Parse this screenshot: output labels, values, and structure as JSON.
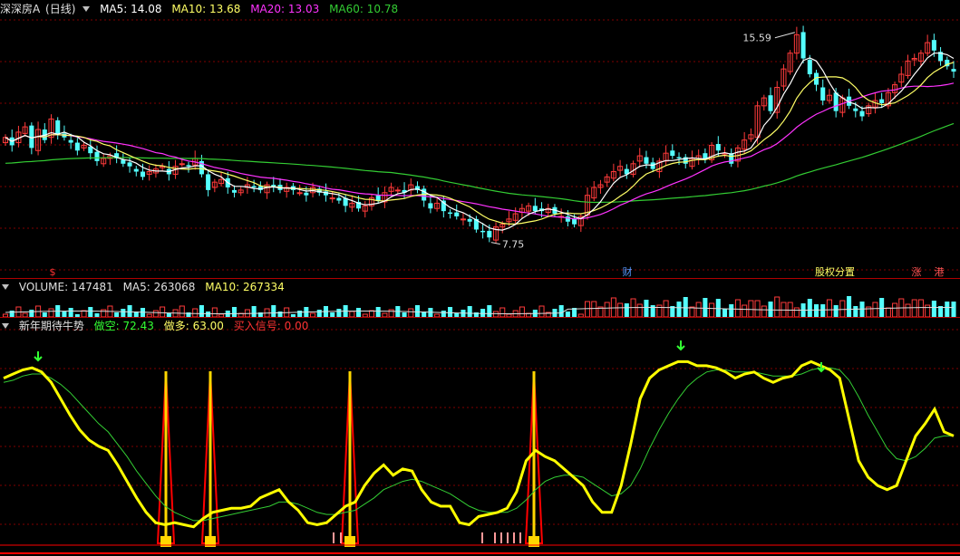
{
  "colors": {
    "bg": "#000000",
    "grid": "#800000",
    "up": "#ff3b3b",
    "down": "#54ffff",
    "ma5": "#ffffff",
    "ma10": "#ffff66",
    "ma20": "#ff33ff",
    "ma60": "#33cc33",
    "fast": "#ffff00",
    "slow": "#33cc33",
    "signal": "#ff0000",
    "signal_fill": "#ffd700"
  },
  "price_panel": {
    "title": "深深房A",
    "period": "(日线)",
    "ma5": "MA5: 14.08",
    "ma10": "MA10: 13.68",
    "ma20": "MA20: 13.03",
    "ma60": "MA60: 10.78",
    "high_label": "15.59",
    "low_label": "7.75",
    "markers": [
      "$",
      "财",
      "股权分置",
      "涨",
      "港"
    ]
  },
  "volume_panel": {
    "title": "VOLUME: 147481",
    "ma5": "MA5: 263068",
    "ma10": "MA10: 267334"
  },
  "indicator_panel": {
    "title": "新年期待牛势",
    "short": "做空: 72.43",
    "long": "做多: 63.00",
    "buy": "买入信号: 0.00"
  },
  "chart_data": [
    {
      "type": "candlestick",
      "name": "price",
      "ylim": [
        6.5,
        16.2
      ],
      "close": [
        11.6,
        11.3,
        11.8,
        12.0,
        11.2,
        11.9,
        11.5,
        12.3,
        11.7,
        11.6,
        11.4,
        11.1,
        11.3,
        11.0,
        10.7,
        10.8,
        10.9,
        10.8,
        10.6,
        10.5,
        10.3,
        10.1,
        10.3,
        10.4,
        10.5,
        10.2,
        10.5,
        10.6,
        10.5,
        10.8,
        10.2,
        9.6,
        9.9,
        10.0,
        9.7,
        9.5,
        9.6,
        9.8,
        9.7,
        9.6,
        9.8,
        9.7,
        9.6,
        9.7,
        9.6,
        9.5,
        9.4,
        9.7,
        9.5,
        9.4,
        9.3,
        9.2,
        9.0,
        9.1,
        8.9,
        9.0,
        9.3,
        9.2,
        9.5,
        9.7,
        9.6,
        9.5,
        9.8,
        9.6,
        9.2,
        8.9,
        9.1,
        8.8,
        8.7,
        8.6,
        8.5,
        8.4,
        8.1,
        8.0,
        7.8,
        8.2,
        8.3,
        8.5,
        8.7,
        8.9,
        9.0,
        8.8,
        8.8,
        8.9,
        8.7,
        8.6,
        8.4,
        8.3,
        8.6,
        9.4,
        9.7,
        9.8,
        10.1,
        10.3,
        10.5,
        10.2,
        10.6,
        10.9,
        10.6,
        10.4,
        10.7,
        11.0,
        10.9,
        10.8,
        10.6,
        10.8,
        10.9,
        10.8,
        11.3,
        11.1,
        11.0,
        10.6,
        11.2,
        11.5,
        11.7,
        12.8,
        13.1,
        12.6,
        13.5,
        14.2,
        14.8,
        15.5,
        14.6,
        14.0,
        13.6,
        13.0,
        13.2,
        12.6,
        13.1,
        12.8,
        12.6,
        12.4,
        12.8,
        13.0,
        12.9,
        13.3,
        13.6,
        14.0,
        14.5,
        14.6,
        14.8,
        15.2,
        14.9,
        14.5,
        14.3,
        14.1
      ],
      "high_value": 15.59,
      "low_value": 7.75
    },
    {
      "type": "line",
      "name": "新年期待牛势",
      "ylim": [
        0,
        100
      ],
      "series": [
        {
          "name": "做空",
          "values": [
            80,
            82,
            84,
            85,
            83,
            78,
            70,
            62,
            55,
            50,
            47,
            45,
            38,
            30,
            22,
            15,
            10,
            9,
            10,
            9,
            8,
            12,
            15,
            16,
            17,
            17,
            18,
            22,
            24,
            26,
            20,
            16,
            10,
            9,
            10,
            14,
            18,
            20,
            28,
            34,
            38,
            33,
            36,
            35,
            26,
            20,
            18,
            18,
            10,
            9,
            13,
            14,
            15,
            17,
            25,
            40,
            45,
            42,
            40,
            36,
            32,
            28,
            20,
            15,
            15,
            28,
            48,
            70,
            80,
            84,
            86,
            88,
            88,
            86,
            86,
            85,
            83,
            80,
            82,
            83,
            80,
            78,
            80,
            81,
            86,
            88,
            86,
            84,
            80,
            60,
            40,
            32,
            28,
            26,
            28,
            40,
            52,
            58,
            65,
            54,
            52
          ]
        },
        {
          "name": "做多",
          "values": [
            78,
            79,
            81,
            82,
            82,
            80,
            77,
            73,
            68,
            63,
            58,
            54,
            48,
            42,
            35,
            29,
            23,
            18,
            15,
            13,
            11,
            11,
            12,
            13,
            14,
            15,
            16,
            17,
            18,
            20,
            20,
            19,
            17,
            15,
            14,
            14,
            15,
            16,
            19,
            22,
            26,
            28,
            30,
            31,
            30,
            28,
            26,
            24,
            21,
            18,
            16,
            15,
            15,
            15,
            17,
            21,
            26,
            30,
            32,
            33,
            33,
            32,
            29,
            26,
            23,
            24,
            28,
            36,
            46,
            55,
            63,
            70,
            76,
            80,
            83,
            84,
            84,
            83,
            83,
            83,
            82,
            81,
            81,
            81,
            82,
            84,
            85,
            85,
            84,
            79,
            71,
            62,
            54,
            46,
            41,
            40,
            42,
            46,
            51,
            52,
            52
          ]
        }
      ],
      "buy_signal_days": [
        3,
        4,
        6,
        7,
        9,
        12,
        14
      ]
    }
  ]
}
